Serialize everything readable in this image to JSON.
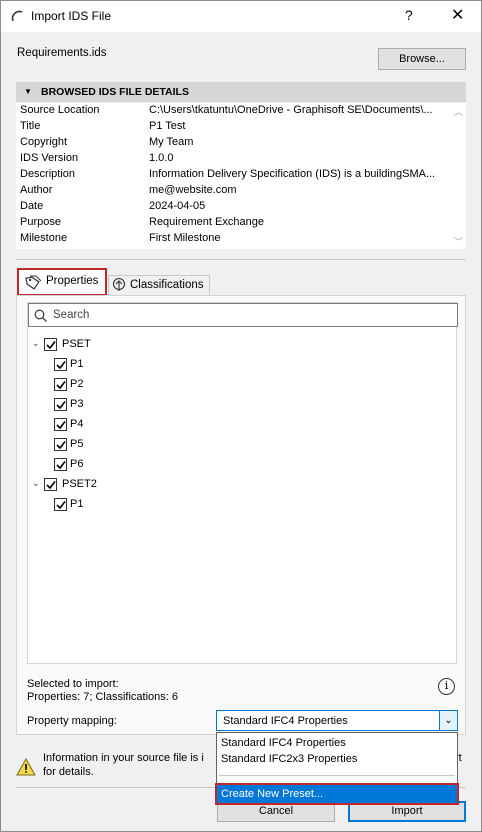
{
  "window": {
    "title": "Import IDS File",
    "help": "?",
    "close": "✕"
  },
  "file": {
    "name": "Requirements.ids",
    "browse_label": "Browse..."
  },
  "details": {
    "header": "BROWSED IDS FILE DETAILS",
    "rows": [
      {
        "key": "Source Location",
        "value": "C:\\Users\\tkatuntu\\OneDrive - Graphisoft SE\\Documents\\..."
      },
      {
        "key": "Title",
        "value": "P1 Test"
      },
      {
        "key": "Copyright",
        "value": "My Team"
      },
      {
        "key": "IDS Version",
        "value": "1.0.0"
      },
      {
        "key": "Description",
        "value": "Information Delivery Specification (IDS) is a buildingSMA..."
      },
      {
        "key": "Author",
        "value": "me@website.com"
      },
      {
        "key": "Date",
        "value": "2024-04-05"
      },
      {
        "key": "Purpose",
        "value": "Requirement Exchange"
      },
      {
        "key": "Milestone",
        "value": "First Milestone"
      }
    ]
  },
  "tabs": {
    "properties": "Properties",
    "classifications": "Classifications"
  },
  "search": {
    "placeholder": "Search"
  },
  "tree": {
    "groups": [
      {
        "label": "PSET",
        "items": [
          "P1",
          "P2",
          "P3",
          "P4",
          "P5",
          "P6"
        ]
      },
      {
        "label": "PSET2",
        "items": [
          "P1"
        ]
      }
    ]
  },
  "selection": {
    "heading": "Selected to import:",
    "summary": "Properties: 7; Classifications: 6"
  },
  "mapping": {
    "label": "Property mapping:",
    "selected": "Standard IFC4 Properties",
    "options": [
      "Standard IFC4 Properties",
      "Standard IFC2x3 Properties"
    ],
    "create_new": "Create New Preset..."
  },
  "warning": {
    "line1_start": "Information in your source file is i",
    "line1_end": "rt",
    "line2": "for details."
  },
  "buttons": {
    "cancel": "Cancel",
    "import": "Import"
  }
}
